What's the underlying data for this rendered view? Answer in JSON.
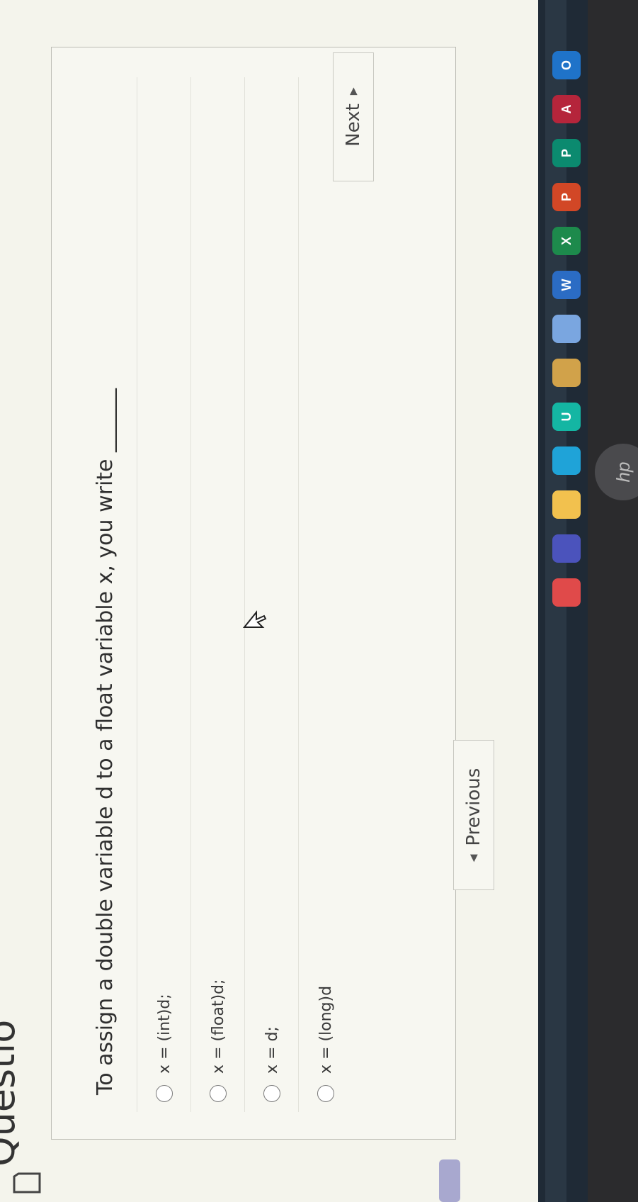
{
  "heading": "Questio",
  "question": {
    "text": "To assign a double variable d to a float variable x, you write ______",
    "options": [
      {
        "label": "x = (int)d;"
      },
      {
        "label": "x = (float)d;"
      },
      {
        "label": "x = d;"
      },
      {
        "label": "x = (long)d"
      }
    ]
  },
  "navigation": {
    "previous_label": "Previous",
    "next_label": "Next"
  },
  "taskbar": {
    "icons": [
      {
        "name": "store-icon",
        "glyph": "",
        "color": "#e04a4a"
      },
      {
        "name": "teams-icon",
        "glyph": "",
        "color": "#4b53bc"
      },
      {
        "name": "file-explorer-icon",
        "glyph": "",
        "color": "#f2c14e"
      },
      {
        "name": "edge-icon",
        "glyph": "",
        "color": "#1fa3d8"
      },
      {
        "name": "uworld-icon",
        "glyph": "U",
        "color": "#14b6a3"
      },
      {
        "name": "app-icon",
        "glyph": "",
        "color": "#d1a24a"
      },
      {
        "name": "photos-icon",
        "glyph": "",
        "color": "#7aa6e0"
      },
      {
        "name": "word-icon",
        "glyph": "W",
        "color": "#2b6cc4"
      },
      {
        "name": "excel-icon",
        "glyph": "X",
        "color": "#1d8a4c"
      },
      {
        "name": "powerpoint-icon",
        "glyph": "P",
        "color": "#d24726"
      },
      {
        "name": "publisher-icon",
        "glyph": "P",
        "color": "#0b8a6f"
      },
      {
        "name": "access-icon",
        "glyph": "A",
        "color": "#b5253b"
      },
      {
        "name": "outlook-icon",
        "glyph": "O",
        "color": "#1f73c9"
      }
    ]
  },
  "brand": "hp"
}
